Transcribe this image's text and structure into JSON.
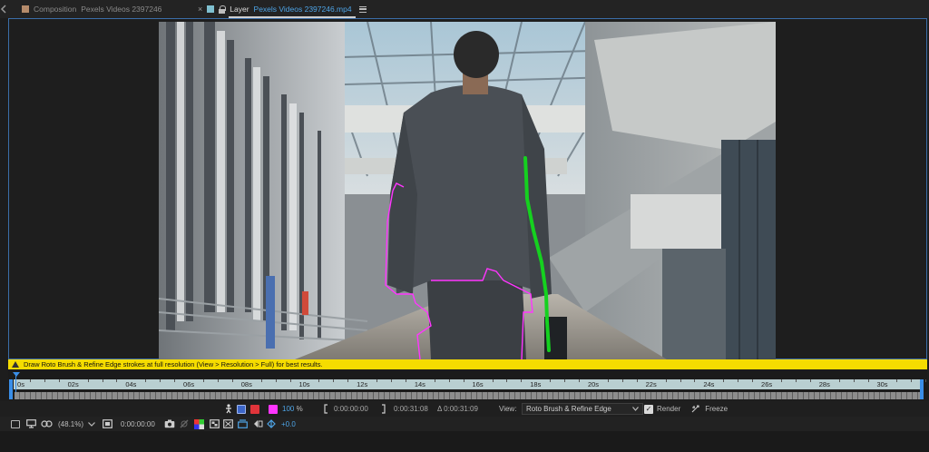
{
  "tabs": {
    "composition": {
      "prefix": "Composition",
      "name": "Pexels Videos 2397246"
    },
    "layer": {
      "close": "×",
      "prefix": "Layer",
      "name": "Pexels Videos 2397246.mp4"
    }
  },
  "warning": "Draw Roto Brush & Refine Edge strokes at full resolution (View > Resolution > Full) for best results.",
  "timeline": {
    "labels": [
      "0s",
      "02s",
      "04s",
      "06s",
      "08s",
      "10s",
      "12s",
      "14s",
      "16s",
      "18s",
      "20s",
      "22s",
      "24s",
      "26s",
      "28s",
      "30s"
    ]
  },
  "roto_toolbar": {
    "opacity_value": "100",
    "opacity_unit": "%",
    "in_time": "0:00:00:00",
    "out_time": "0:00:31:08",
    "duration": "Δ 0:00:31:09",
    "view_label": "View:",
    "view_value": "Roto Brush & Refine Edge",
    "render_label": "Render",
    "render_checked": true,
    "freeze_label": "Freeze"
  },
  "status": {
    "zoom": "(48.1%)",
    "current_time": "0:00:00:00",
    "exposure": "+0.0"
  },
  "colors": {
    "accent": "#3a8ee8",
    "warning_bg": "#f5dc00",
    "roto_stroke": "#15d11f",
    "mask_outline": "#ff35ff"
  }
}
